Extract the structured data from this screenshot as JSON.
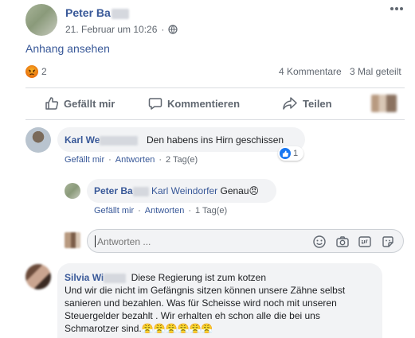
{
  "post": {
    "author": "Peter Ba",
    "timestamp": "21. Februar um 10:26",
    "dot": "·",
    "privacy_icon": "globe-icon",
    "attachment_link": "Anhang ansehen",
    "reaction_count": "2",
    "comments_count": "4 Kommentare",
    "shares_count": "3 Mal geteilt",
    "more_icon": "ellipsis-icon"
  },
  "actions": {
    "like": "Gefällt mir",
    "comment": "Kommentieren",
    "share": "Teilen"
  },
  "comments": [
    {
      "author": "Karl We",
      "text": "Den habens ins Hirn geschissen",
      "like": "Gefällt mir",
      "reply": "Antworten",
      "time": "2 Tag(e)",
      "reaction_count": "1"
    },
    {
      "author": "Peter Ba",
      "mention": "Karl Weindorfer",
      "text": " Genau",
      "emoji": "😠",
      "like": "Gefällt mir",
      "reply": "Antworten",
      "time": "1 Tag(e)"
    }
  ],
  "reply_input": {
    "placeholder": "Antworten ..."
  },
  "comment3": {
    "author": "Silvia Wi",
    "text_first": "Diese Regierung ist zum kotzen",
    "text_rest": "Und wir die nicht im Gefängnis sitzen können unsere Zähne selbst sanieren und bezahlen. Was für Scheisse wird noch mit unseren Steuergelder bezahlt . Wir erhalten eh schon alle die bei uns Schmarotzer sind.",
    "emojis": "😤😤😤😤😤😤"
  },
  "separator": "·",
  "colors": {
    "link": "#385898",
    "muted": "#606770",
    "bubble": "#f2f3f5",
    "like_blue": "#1877f2",
    "angry": "#e9710f"
  }
}
